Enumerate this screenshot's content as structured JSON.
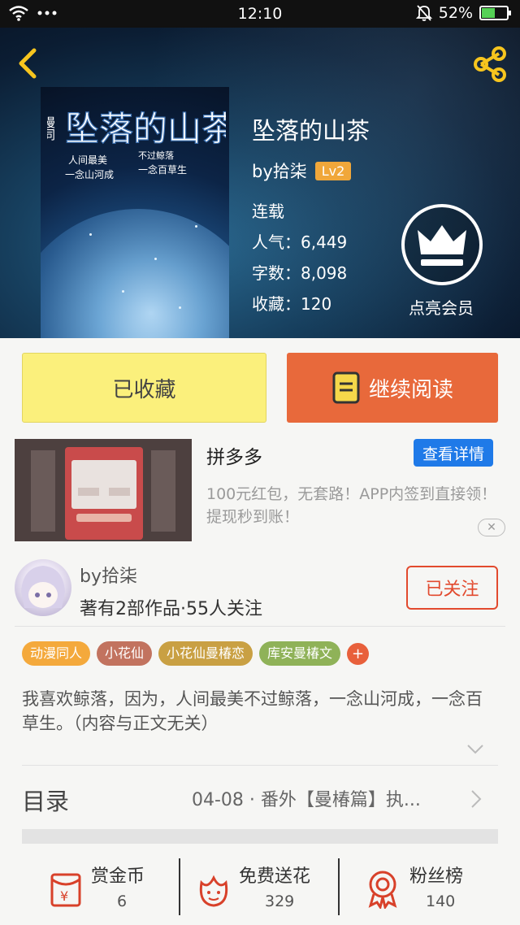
{
  "status_bar": {
    "time": "12:10",
    "battery": "52%",
    "battery_level": 0.52,
    "icons": [
      "wifi-icon",
      "more-dots-icon",
      "mute-icon",
      "battery-charging-icon"
    ]
  },
  "header": {
    "back_icon": "chevron-left-icon",
    "share_icon": "share-icon",
    "book_title": "坠落的山茶",
    "author": "by拾柒",
    "author_level": "Lv2",
    "status": "连载",
    "popularity": "人气：6,449",
    "word_count": "字数：8,098",
    "favorites": "收藏：120",
    "vip_label": "点亮会员",
    "cover_text": {
      "series": "漫同",
      "title": "坠落的山茶",
      "line1": "人间最美",
      "line2": "不过鲸落",
      "line3": "一念山河成",
      "line4": "一念百草生"
    }
  },
  "actions": {
    "collected_label": "已收藏",
    "read_label": "继续阅读"
  },
  "ad": {
    "title": "拼多多",
    "detail_button": "查看详情",
    "description": "100元红包，无套路！APP内签到直接领！提现秒到账！",
    "close_symbol": "✕"
  },
  "author_section": {
    "name": "by拾柒",
    "stats": "著有2部作品·55人关注",
    "follow_label": "已关注"
  },
  "tags": [
    {
      "label": "动漫同人",
      "color": "#f4a93c"
    },
    {
      "label": "小花仙",
      "color": "#c2735f"
    },
    {
      "label": "小花仙曼椿恋",
      "color": "#c9a043"
    },
    {
      "label": "库安曼椿文",
      "color": "#8fb258"
    }
  ],
  "tag_add": "+",
  "synopsis": "我喜欢鲸落，因为，人间最美不过鲸落，一念山河成，一念百草生。（内容与正文无关）",
  "toc": {
    "title": "目录",
    "latest": "04-08 · 番外【曼椿篇】执..."
  },
  "bottom_bar": {
    "reward": {
      "label": "赏金币",
      "value": "6"
    },
    "flowers": {
      "label": "免费送花",
      "value": "329"
    },
    "fans": {
      "label": "粉丝榜",
      "value": "140"
    }
  },
  "colors": {
    "accent_orange": "#e8693b",
    "collected_yellow": "#fbf07c",
    "follow_red": "#e24a2e",
    "detail_blue": "#1f7ae8",
    "icon_red": "#d8412a"
  }
}
